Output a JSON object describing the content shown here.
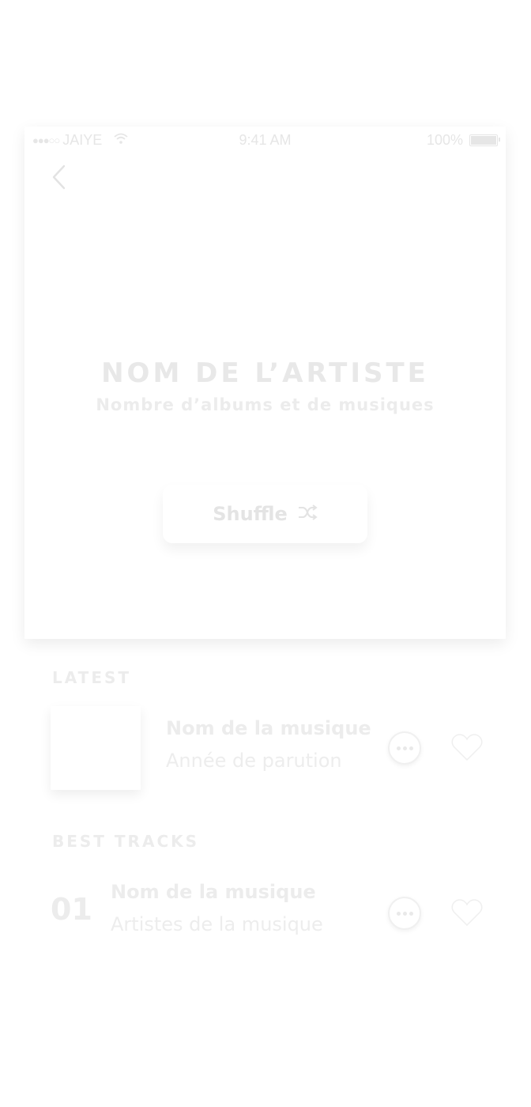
{
  "status_bar": {
    "carrier": "JAIYE",
    "signal_dots": "●●●○○",
    "time": "9:41 AM",
    "battery": "100%"
  },
  "icons": {
    "back": "chevron-left-icon",
    "shuffle": "shuffle-icon",
    "more": "more-horizontal-icon",
    "heart": "heart-icon",
    "wifi": "wifi-icon",
    "battery": "battery-icon"
  },
  "header": {
    "artist_name": "NOM DE L’ARTISTE",
    "artist_subtitle": "Nombre d’albums et de musiques",
    "shuffle_label": "Shuffle"
  },
  "latest": {
    "title": "LATEST",
    "item": {
      "name": "Nom de la musique",
      "year": "Année de parution"
    }
  },
  "best_tracks": {
    "title": "BEST TRACKS",
    "items": [
      {
        "number": "01",
        "name": "Nom de la musique",
        "artists": "Artistes de la musique"
      }
    ]
  },
  "colors": {
    "background": "#ffffff",
    "faded_text": "#e8e8e8"
  }
}
